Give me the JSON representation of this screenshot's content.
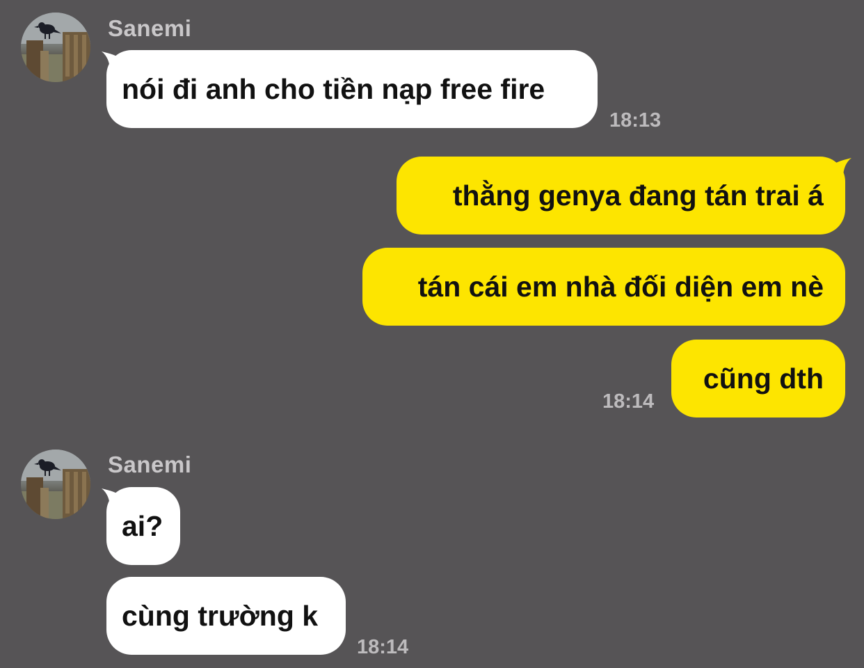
{
  "chat": {
    "groups": [
      {
        "sender": "Sanemi",
        "messages": [
          "nói đi anh cho tiền nạp free fire"
        ],
        "time": "18:13"
      },
      {
        "messages": [
          "thằng genya đang tán trai á",
          "tán cái em nhà đối diện em nè",
          "cũng dth"
        ],
        "time": "18:14"
      },
      {
        "sender": "Sanemi",
        "messages": [
          "ai?",
          "cùng trường k"
        ],
        "time": "18:14"
      }
    ]
  },
  "colors": {
    "background": "#565456",
    "incoming_bubble": "#ffffff",
    "outgoing_bubble": "#fde500",
    "sender_name": "#c9c7c9",
    "timestamp": "#bdbbbd"
  },
  "icons": {
    "avatar": "crow-on-fence-avatar-icon"
  }
}
